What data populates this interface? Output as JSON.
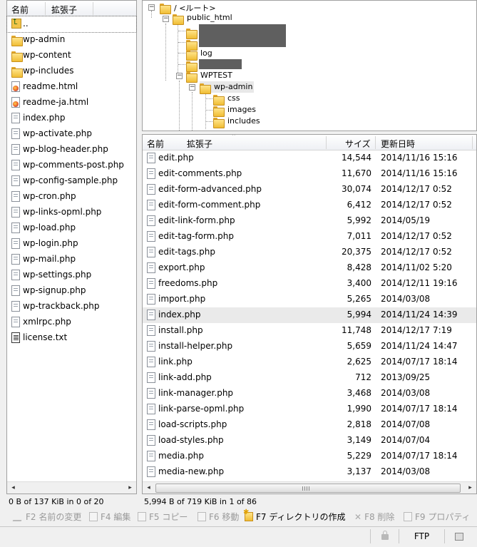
{
  "left_pane": {
    "columns": {
      "name": "名前",
      "ext": "拡張子"
    },
    "items": [
      {
        "label": "..",
        "icon": "up-folder-icon",
        "kind": "up"
      },
      {
        "label": "wp-admin",
        "icon": "folder-icon",
        "kind": "folder"
      },
      {
        "label": "wp-content",
        "icon": "folder-icon",
        "kind": "folder"
      },
      {
        "label": "wp-includes",
        "icon": "folder-icon",
        "kind": "folder"
      },
      {
        "label": "readme.html",
        "icon": "html-file-icon",
        "kind": "html"
      },
      {
        "label": "readme-ja.html",
        "icon": "html-file-icon",
        "kind": "html"
      },
      {
        "label": "index.php",
        "icon": "file-icon",
        "kind": "file"
      },
      {
        "label": "wp-activate.php",
        "icon": "file-icon",
        "kind": "file"
      },
      {
        "label": "wp-blog-header.php",
        "icon": "file-icon",
        "kind": "file"
      },
      {
        "label": "wp-comments-post.php",
        "icon": "file-icon",
        "kind": "file"
      },
      {
        "label": "wp-config-sample.php",
        "icon": "file-icon",
        "kind": "file"
      },
      {
        "label": "wp-cron.php",
        "icon": "file-icon",
        "kind": "file"
      },
      {
        "label": "wp-links-opml.php",
        "icon": "file-icon",
        "kind": "file"
      },
      {
        "label": "wp-load.php",
        "icon": "file-icon",
        "kind": "file"
      },
      {
        "label": "wp-login.php",
        "icon": "file-icon",
        "kind": "file"
      },
      {
        "label": "wp-mail.php",
        "icon": "file-icon",
        "kind": "file"
      },
      {
        "label": "wp-settings.php",
        "icon": "file-icon",
        "kind": "file"
      },
      {
        "label": "wp-signup.php",
        "icon": "file-icon",
        "kind": "file"
      },
      {
        "label": "wp-trackback.php",
        "icon": "file-icon",
        "kind": "file"
      },
      {
        "label": "xmlrpc.php",
        "icon": "file-icon",
        "kind": "file"
      },
      {
        "label": "license.txt",
        "icon": "text-file-icon",
        "kind": "txt"
      }
    ],
    "status": "0 B of 137 KiB in 0 of 20"
  },
  "tree": {
    "root": "/ <ルート>",
    "public_html": "public_html",
    "log": "log",
    "wptest": "WPTEST",
    "wp_admin": "wp-admin",
    "css": "css",
    "images": "images",
    "includes": "includes"
  },
  "right_pane": {
    "columns": {
      "name": "名前",
      "ext": "拡張子",
      "size": "サイズ",
      "modified": "更新日時"
    },
    "rows": [
      {
        "name": "edit.php",
        "size": "14,544",
        "date": "2014/11/16 15:16"
      },
      {
        "name": "edit-comments.php",
        "size": "11,670",
        "date": "2014/11/16 15:16"
      },
      {
        "name": "edit-form-advanced.php",
        "size": "30,074",
        "date": "2014/12/17 0:52"
      },
      {
        "name": "edit-form-comment.php",
        "size": "6,412",
        "date": "2014/12/17 0:52"
      },
      {
        "name": "edit-link-form.php",
        "size": "5,992",
        "date": "2014/05/19"
      },
      {
        "name": "edit-tag-form.php",
        "size": "7,011",
        "date": "2014/12/17 0:52"
      },
      {
        "name": "edit-tags.php",
        "size": "20,375",
        "date": "2014/12/17 0:52"
      },
      {
        "name": "export.php",
        "size": "8,428",
        "date": "2014/11/02 5:20"
      },
      {
        "name": "freedoms.php",
        "size": "3,400",
        "date": "2014/12/11 19:16"
      },
      {
        "name": "import.php",
        "size": "5,265",
        "date": "2014/03/08"
      },
      {
        "name": "index.php",
        "size": "5,994",
        "date": "2014/11/24 14:39",
        "selected": true
      },
      {
        "name": "install.php",
        "size": "11,748",
        "date": "2014/12/17 7:19"
      },
      {
        "name": "install-helper.php",
        "size": "5,659",
        "date": "2014/11/24 14:47"
      },
      {
        "name": "link.php",
        "size": "2,625",
        "date": "2014/07/17 18:14"
      },
      {
        "name": "link-add.php",
        "size": "712",
        "date": "2013/09/25"
      },
      {
        "name": "link-manager.php",
        "size": "3,468",
        "date": "2014/03/08"
      },
      {
        "name": "link-parse-opml.php",
        "size": "1,990",
        "date": "2014/07/17 18:14"
      },
      {
        "name": "load-scripts.php",
        "size": "2,818",
        "date": "2014/07/08"
      },
      {
        "name": "load-styles.php",
        "size": "3,149",
        "date": "2014/07/04"
      },
      {
        "name": "media.php",
        "size": "5,229",
        "date": "2014/07/17 18:14"
      },
      {
        "name": "media-new.php",
        "size": "3,137",
        "date": "2014/03/08"
      }
    ],
    "status": "5,994 B of 719 KiB in 1 of 86"
  },
  "toolbar": {
    "f2": "F2 名前の変更",
    "f4": "F4 編集",
    "f5": "F5 コピー",
    "f6": "F6 移動",
    "f7": "F7 ディレクトリの作成",
    "f8": "F8 削除",
    "f9": "F9 プロパティ"
  },
  "statusbar": {
    "protocol": "FTP"
  },
  "colors": {
    "selected_row": "#eaeaea",
    "pane_border": "#a0a0a0",
    "folder": "#f0bd34",
    "redaction": "#5f5f5f"
  }
}
